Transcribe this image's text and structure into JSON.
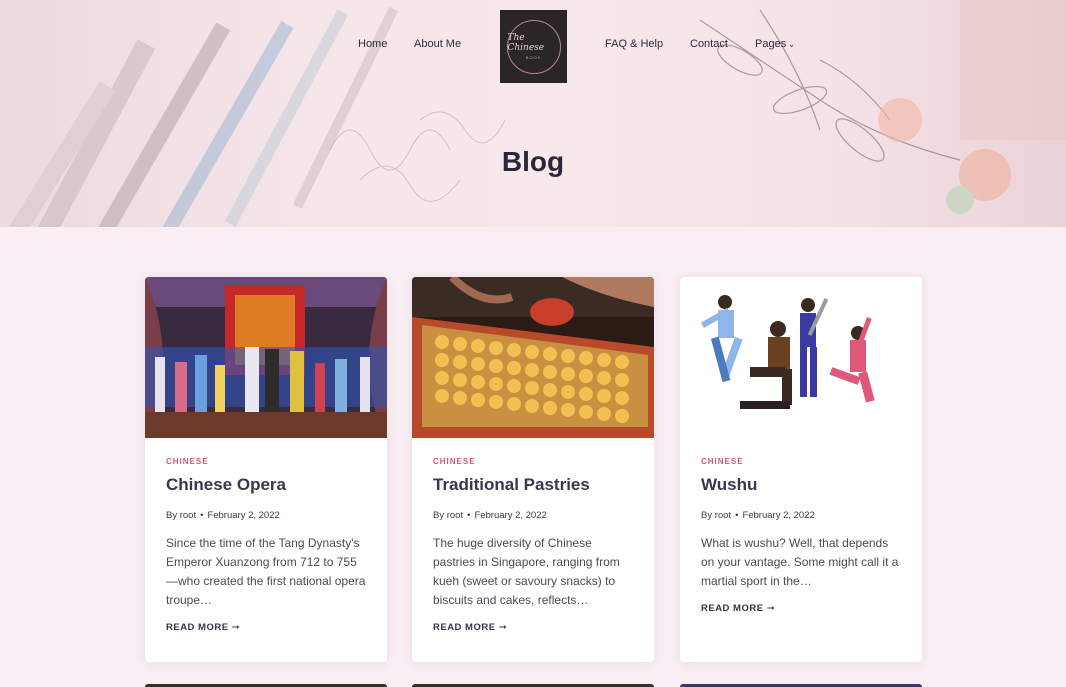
{
  "nav": {
    "home": "Home",
    "about": "About Me",
    "faq": "FAQ & Help",
    "contact": "Contact",
    "pages": "Pages",
    "pages_chevron": "⌄"
  },
  "logo": {
    "text": "The Chinese",
    "sub": "BOOK"
  },
  "page_title": "Blog",
  "posts": [
    {
      "category": "CHINESE",
      "title": "Chinese Opera",
      "by": "By",
      "author": "root",
      "date": "February 2, 2022",
      "excerpt": "Since the time of the Tang Dynasty's Emperor Xuanzong from 712 to 755—who created the first national opera troupe…",
      "read_more": "READ MORE ➞"
    },
    {
      "category": "CHINESE",
      "title": "Traditional Pastries",
      "by": "By",
      "author": "root",
      "date": "February 2, 2022",
      "excerpt": "The huge diversity of Chinese pastries in Singapore, ranging from kueh (sweet or savoury snacks) to biscuits and cakes, reflects…",
      "read_more": "READ MORE ➞"
    },
    {
      "category": "CHINESE",
      "title": "Wushu",
      "by": "By",
      "author": "root",
      "date": "February 2, 2022",
      "excerpt": "What is wushu? Well, that depends on your vantage. Some might call it a martial sport in the…",
      "read_more": "READ MORE ➞"
    }
  ],
  "colors": {
    "accent": "#d9556e",
    "background": "#f8eef3",
    "title": "#3d3450"
  }
}
